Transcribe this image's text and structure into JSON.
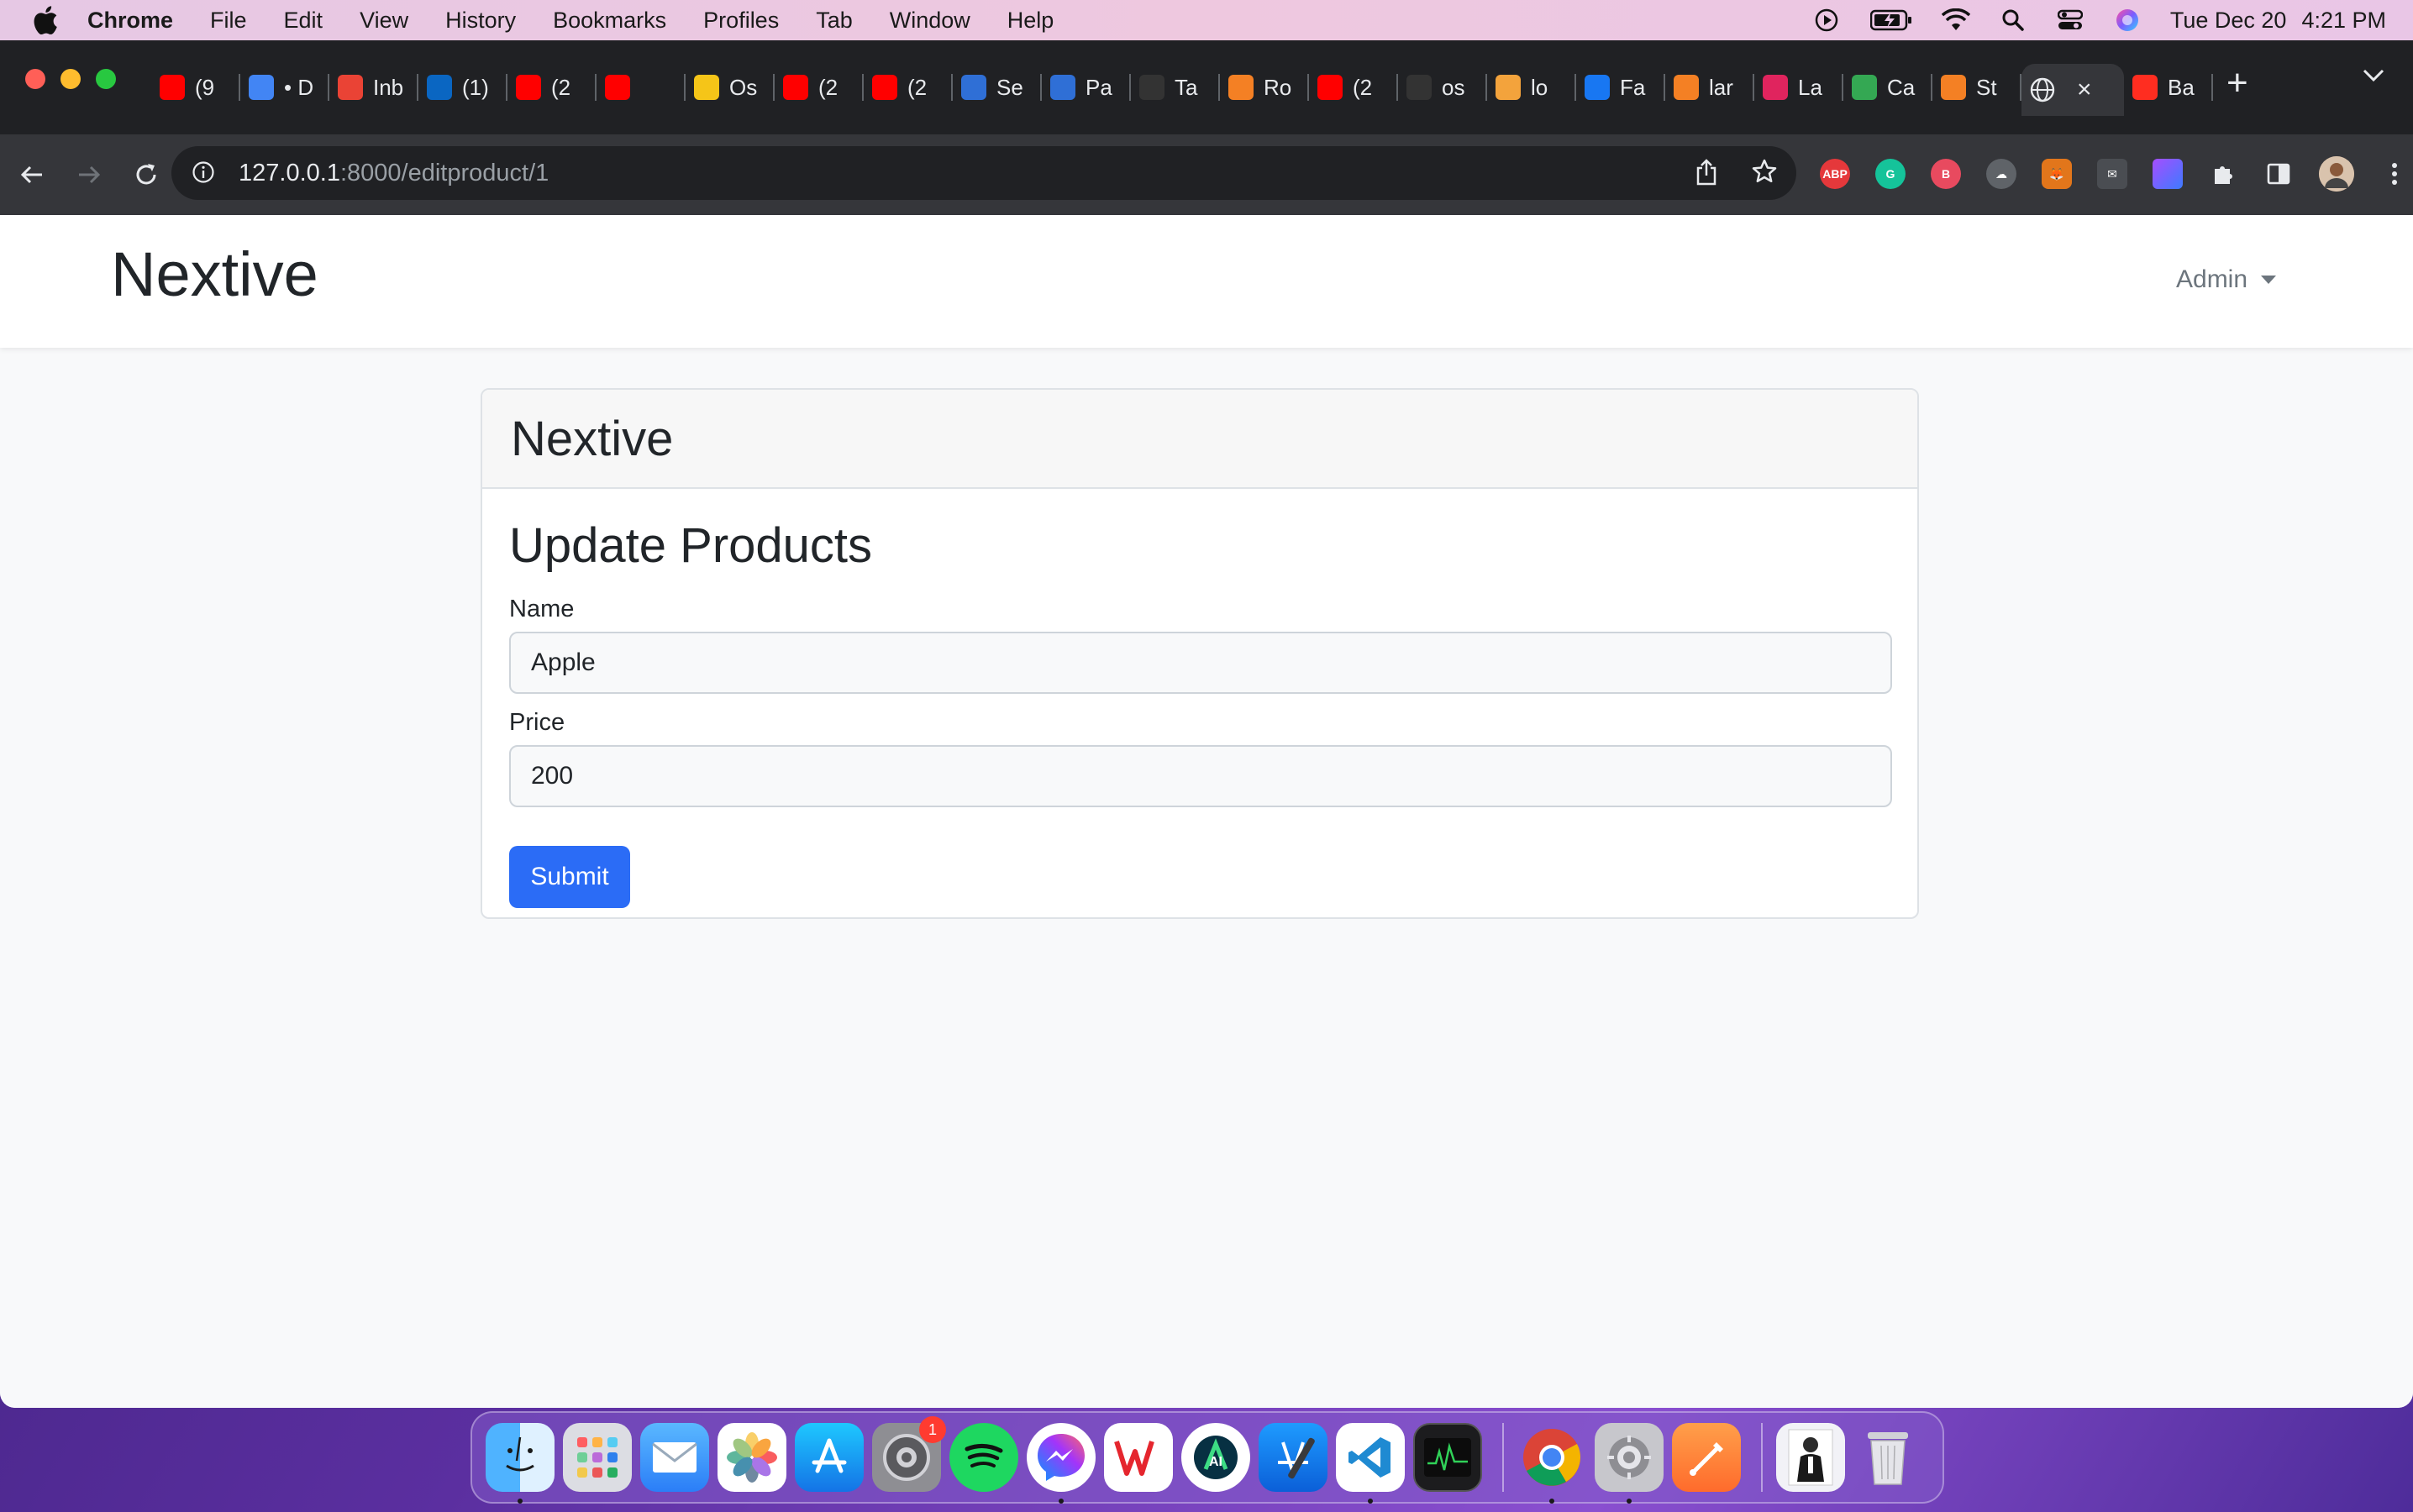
{
  "menubar": {
    "app": "Chrome",
    "items": [
      "File",
      "Edit",
      "View",
      "History",
      "Bookmarks",
      "Profiles",
      "Tab",
      "Window",
      "Help"
    ],
    "day": "Tue Dec 20",
    "time": "4:21 PM"
  },
  "browser": {
    "tabs": [
      {
        "label": "(9",
        "color": "#ff0000"
      },
      {
        "label": "• D",
        "color": "#4285f4"
      },
      {
        "label": "Inb",
        "color": "#ea4335"
      },
      {
        "label": "(1)",
        "color": "#0a66c2"
      },
      {
        "label": "(2",
        "color": "#ff0000"
      },
      {
        "label": "",
        "color": "#ff0000"
      },
      {
        "label": "Os",
        "color": "#f5c518"
      },
      {
        "label": "(2",
        "color": "#ff0000"
      },
      {
        "label": "(2",
        "color": "#ff0000"
      },
      {
        "label": "Se",
        "color": "#2f6fd6"
      },
      {
        "label": "Pa",
        "color": "#2f6fd6"
      },
      {
        "label": "Ta",
        "color": "#333333"
      },
      {
        "label": "Ro",
        "color": "#f48024"
      },
      {
        "label": "(2",
        "color": "#ff0000"
      },
      {
        "label": "os",
        "color": "#333333"
      },
      {
        "label": "lo",
        "color": "#f3a33c"
      },
      {
        "label": "Fa",
        "color": "#1877f2"
      },
      {
        "label": "lar",
        "color": "#f48024"
      },
      {
        "label": "La",
        "color": "#e0245e"
      },
      {
        "label": "Ca",
        "color": "#34a853"
      },
      {
        "label": "St",
        "color": "#f48024"
      }
    ],
    "active_tab": {
      "label": "",
      "close": "×"
    },
    "last_tab": {
      "label": "Ba",
      "color": "#ff2d20"
    },
    "url_host": "127.0.0.1",
    "url_path": ":8000/editproduct/1"
  },
  "navbar": {
    "brand": "Nextive",
    "user_menu": "Admin"
  },
  "card": {
    "header": "Nextive",
    "title": "Update Products",
    "name_label": "Name",
    "name_value": "Apple",
    "price_label": "Price",
    "price_value": "200",
    "submit_label": "Submit"
  },
  "dock": {
    "badge_count": "1"
  }
}
